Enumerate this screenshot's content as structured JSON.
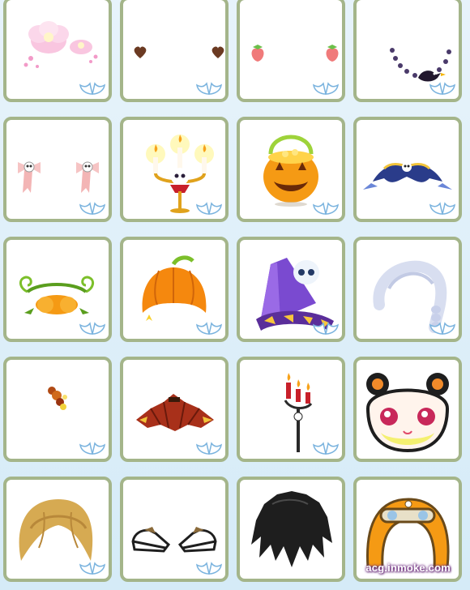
{
  "grid": {
    "columns": 4,
    "rows": 5
  },
  "watermark": "acg.inmoke.com",
  "tiles": [
    {
      "icon": "pink-flower-cloud-icon"
    },
    {
      "icon": "heart-earrings-icon"
    },
    {
      "icon": "strawberry-earrings-icon"
    },
    {
      "icon": "crow-bead-necklace-icon"
    },
    {
      "icon": "skull-bow-earrings-icon"
    },
    {
      "icon": "skull-candelabra-icon"
    },
    {
      "icon": "jack-o-lantern-basket-icon"
    },
    {
      "icon": "skull-mask-headpiece-icon"
    },
    {
      "icon": "pumpkin-vine-headband-icon"
    },
    {
      "icon": "pumpkin-hat-icon"
    },
    {
      "icon": "skull-witch-hat-icon"
    },
    {
      "icon": "silver-braid-wig-icon"
    },
    {
      "icon": "red-hair-clip-icon"
    },
    {
      "icon": "red-gothic-skirt-icon"
    },
    {
      "icon": "candle-staff-icon"
    },
    {
      "icon": "panda-face-mask-icon"
    },
    {
      "icon": "blonde-bob-wig-icon"
    },
    {
      "icon": "black-white-shoes-icon"
    },
    {
      "icon": "black-spiky-wig-icon"
    },
    {
      "icon": "aviator-goggle-helmet-icon"
    }
  ],
  "badge_icon": "angel-wings-icon"
}
